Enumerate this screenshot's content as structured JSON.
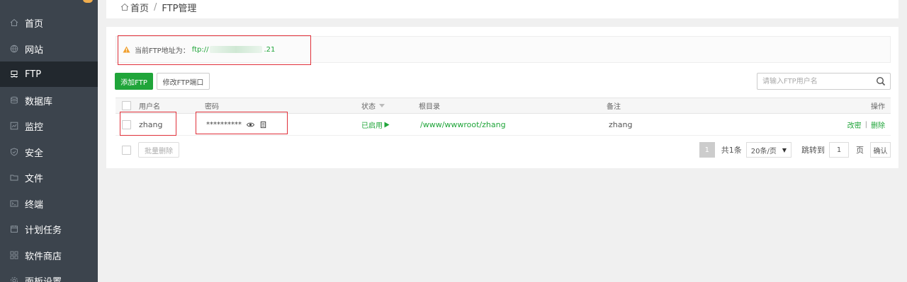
{
  "sidebar": {
    "items": [
      {
        "label": "首页",
        "icon": "home-icon"
      },
      {
        "label": "网站",
        "icon": "globe-icon"
      },
      {
        "label": "FTP",
        "icon": "ftp-icon"
      },
      {
        "label": "数据库",
        "icon": "database-icon"
      },
      {
        "label": "监控",
        "icon": "monitor-icon"
      },
      {
        "label": "安全",
        "icon": "shield-icon"
      },
      {
        "label": "文件",
        "icon": "folder-icon"
      },
      {
        "label": "终端",
        "icon": "terminal-icon"
      },
      {
        "label": "计划任务",
        "icon": "calendar-icon"
      },
      {
        "label": "软件商店",
        "icon": "apps-icon"
      },
      {
        "label": "面板设置",
        "icon": "gear-icon"
      }
    ],
    "active_index": 2
  },
  "breadcrumb": {
    "home": "首页",
    "separator": "/",
    "current": "FTP管理"
  },
  "notice": {
    "label": "当前FTP地址为：",
    "address_prefix": "ftp://",
    "address_suffix": ".21"
  },
  "toolbar": {
    "add_label": "添加FTP",
    "port_label": "修改FTP端口",
    "search_placeholder": "请输入FTP用户名"
  },
  "table": {
    "columns": {
      "username": "用户名",
      "password": "密码",
      "status": "状态",
      "root": "根目录",
      "note": "备注",
      "actions": "操作"
    },
    "rows": [
      {
        "username": "zhang",
        "password": "**********",
        "status": "已启用",
        "root": "/www/wwwroot/zhang",
        "note": "zhang",
        "action_edit": "改密",
        "action_sep": "|",
        "action_delete": "删除"
      }
    ]
  },
  "footer": {
    "batch_delete": "批量删除",
    "current_page": "1",
    "total": "共1条",
    "page_size": "20条/页",
    "jump_label": "跳转到",
    "jump_value": "1",
    "page_unit": "页",
    "confirm": "确认"
  },
  "colors": {
    "accent": "#20a53a",
    "sidebar_bg": "#3c444d",
    "sidebar_active": "#22282e",
    "highlight_box": "#e0303a"
  }
}
